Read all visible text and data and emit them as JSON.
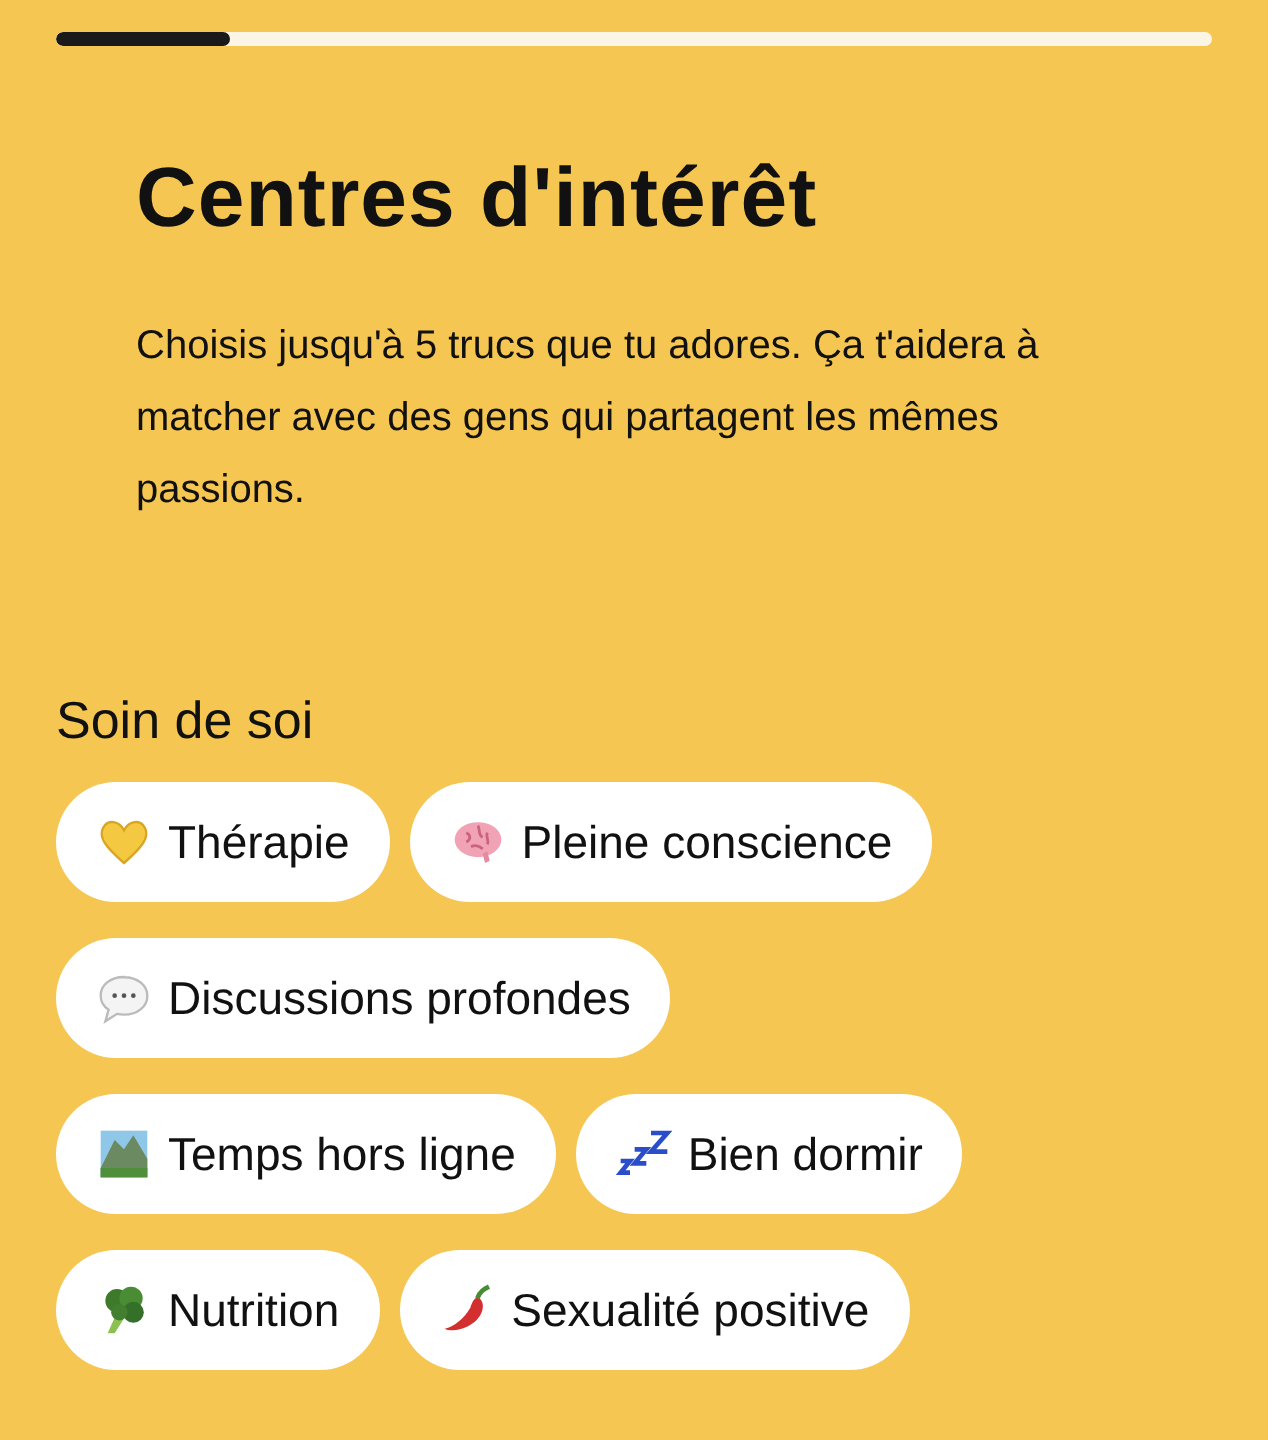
{
  "progress": {
    "level": 0.15
  },
  "title": "Centres d'intérêt",
  "description": "Choisis jusqu'à 5 trucs que tu adores. Ça t'aidera à matcher avec des gens qui partagent les mêmes passions.",
  "section": {
    "heading": "Soin de soi",
    "chips": [
      {
        "label": "Thérapie"
      },
      {
        "label": "Pleine conscience"
      },
      {
        "label": "Discussions profondes"
      },
      {
        "label": "Temps hors ligne"
      },
      {
        "label": "Bien dormir"
      },
      {
        "label": "Nutrition"
      },
      {
        "label": "Sexualité positive"
      }
    ]
  }
}
